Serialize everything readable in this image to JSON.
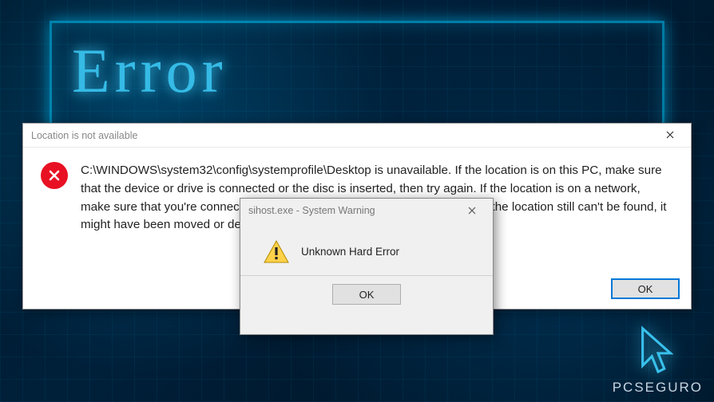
{
  "background": {
    "glow_word": "Error",
    "watermark": "PCSEGURO"
  },
  "main_dialog": {
    "title": "Location is not available",
    "message": "C:\\WINDOWS\\system32\\config\\systemprofile\\Desktop is unavailable. If the location is on this PC, make sure that the device or drive is connected or the disc is inserted, then try again. If the location is on a network, make sure that you're connected to the network or Internet, then try again. If the location still can't be found, it might have been moved or deleted.",
    "ok_label": "OK"
  },
  "warn_dialog": {
    "title": "sihost.exe - System Warning",
    "message": "Unknown Hard Error",
    "ok_label": "OK"
  }
}
